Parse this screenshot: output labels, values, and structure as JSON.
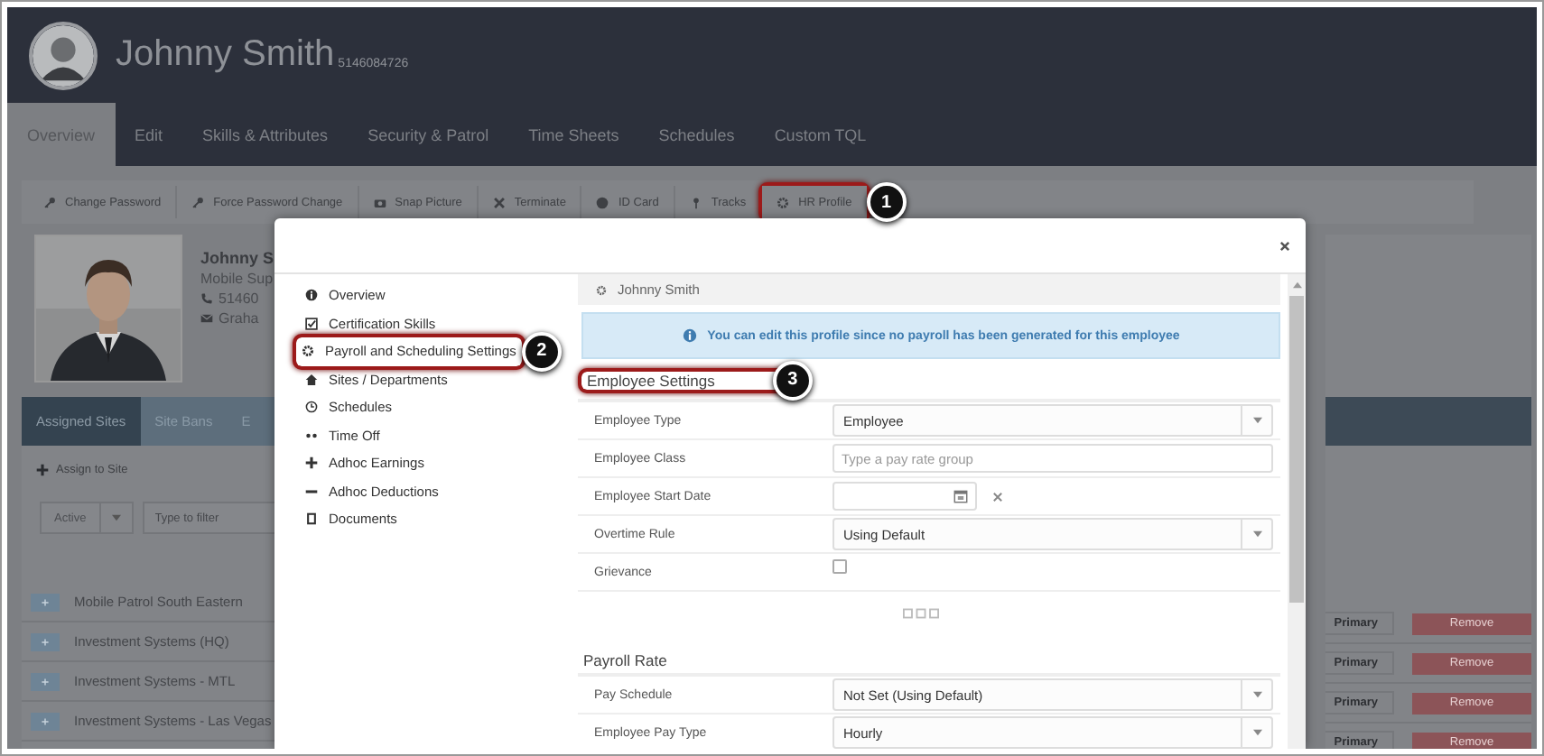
{
  "profile": {
    "name": "Johnny Smith",
    "id": "5146084726"
  },
  "nav_tabs": [
    {
      "label": "Overview",
      "selected": true
    },
    {
      "label": "Edit",
      "selected": false
    },
    {
      "label": "Skills & Attributes",
      "selected": false
    },
    {
      "label": "Security & Patrol",
      "selected": false
    },
    {
      "label": "Time Sheets",
      "selected": false
    },
    {
      "label": "Schedules",
      "selected": false
    },
    {
      "label": "Custom TQL",
      "selected": false
    }
  ],
  "actions": [
    {
      "label": "Change Password"
    },
    {
      "label": "Force Password Change"
    },
    {
      "label": "Snap Picture"
    },
    {
      "label": "Terminate"
    },
    {
      "label": "ID Card"
    },
    {
      "label": "Tracks"
    },
    {
      "label": "HR Profile",
      "callout": "1"
    }
  ],
  "employee_card": {
    "name": "Johnny S",
    "title": "Mobile Sup",
    "phone": "51460",
    "email": "Graha"
  },
  "site_tabs": [
    {
      "label": "Assigned Sites",
      "selected": true
    },
    {
      "label": "Site Bans",
      "selected": false
    },
    {
      "label": "E",
      "selected": false
    }
  ],
  "assign_button": "Assign to Site",
  "status_filter": "Active",
  "filter": {
    "placeholder": "Type to filter"
  },
  "sites": [
    "Mobile Patrol South Eastern",
    "Investment Systems (HQ)",
    "Investment Systems - MTL",
    "Investment Systems - Las Vegas"
  ],
  "site_actions": [
    {
      "primary": "Primary",
      "remove": "Remove"
    },
    {
      "primary": "Primary",
      "remove": "Remove"
    },
    {
      "primary": "Primary",
      "remove": "Remove"
    },
    {
      "primary": "Primary",
      "remove": "Remove"
    }
  ],
  "modal": {
    "menu": [
      {
        "label": "Overview"
      },
      {
        "label": "Certification Skills"
      },
      {
        "label": "Payroll and Scheduling Settings",
        "callout": "2"
      },
      {
        "label": "Sites / Departments"
      },
      {
        "label": "Schedules"
      },
      {
        "label": "Time Off"
      },
      {
        "label": "Adhoc Earnings"
      },
      {
        "label": "Adhoc Deductions"
      },
      {
        "label": "Documents"
      }
    ],
    "breadcrumb": "Johnny Smith",
    "alert": "You can edit this profile since no payroll has been generated for this employee",
    "sections": [
      {
        "title": "Employee Settings",
        "callout": "3",
        "rows": [
          {
            "kind": "select",
            "label": "Employee Type",
            "value": "Employee"
          },
          {
            "kind": "input",
            "label": "Employee Class",
            "placeholder": "Type a pay rate group"
          },
          {
            "kind": "date",
            "label": "Employee Start Date"
          },
          {
            "kind": "select",
            "label": "Overtime Rule",
            "value": "Using Default"
          },
          {
            "kind": "checkbox",
            "label": "Grievance",
            "checked": false
          },
          {
            "kind": "loading"
          }
        ]
      },
      {
        "title": "Payroll Rate",
        "rows": [
          {
            "kind": "select",
            "label": "Pay Schedule",
            "value": "Not Set (Using Default)"
          },
          {
            "kind": "select",
            "label": "Employee Pay Type",
            "value": "Hourly"
          }
        ]
      }
    ]
  }
}
